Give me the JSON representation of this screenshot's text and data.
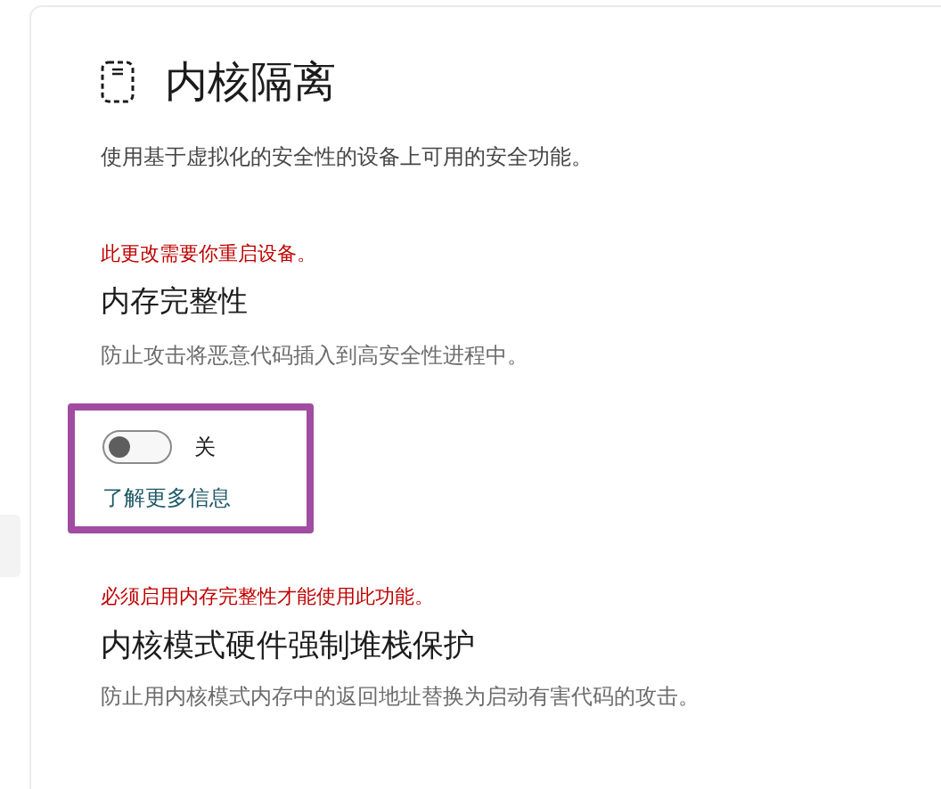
{
  "page": {
    "title": "内核隔离",
    "description": "使用基于虚拟化的安全性的设备上可用的安全功能。"
  },
  "sections": [
    {
      "kind": "toggle",
      "warning": "此更改需要你重启设备。",
      "heading": "内存完整性",
      "description": "防止攻击将恶意代码插入到高安全性进程中。",
      "highlighted": true,
      "toggle": {
        "on": false,
        "label": "关"
      },
      "link": "了解更多信息"
    },
    {
      "kind": "plain",
      "warning": "必须启用内存完整性才能使用此功能。",
      "heading": "内核模式硬件强制堆栈保护",
      "description": "防止用内核模式内存中的返回地址替换为启动有害代码的攻击。"
    }
  ]
}
